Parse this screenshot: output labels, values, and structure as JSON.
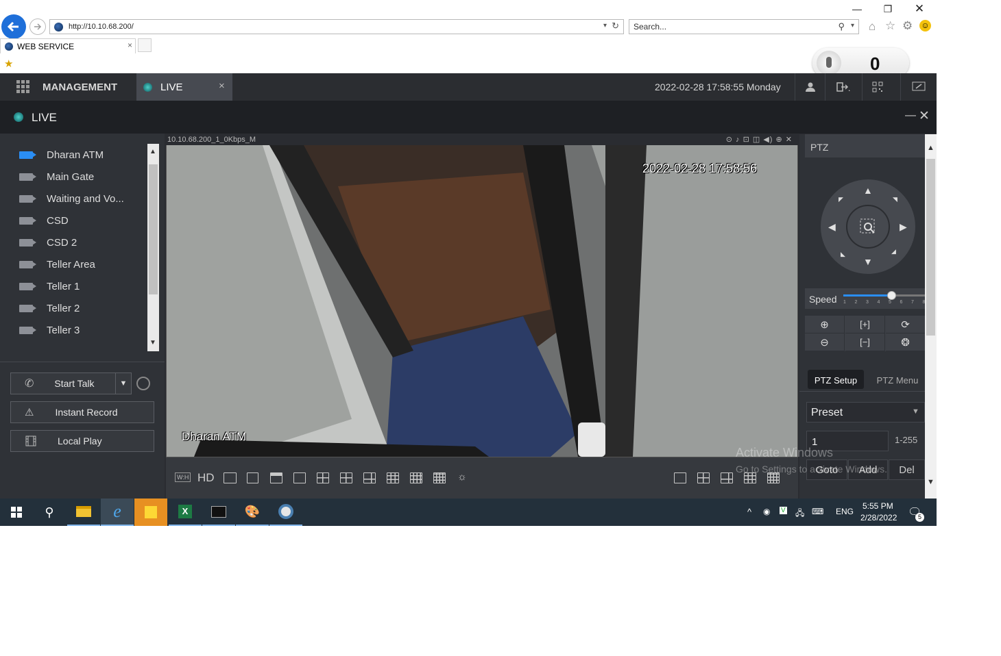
{
  "browser": {
    "address": "http://10.10.68.200/",
    "search_placeholder": "Search...",
    "tab_title": "WEB SERVICE",
    "notification_count": "0"
  },
  "topnav": {
    "management_label": "MANAGEMENT",
    "live_tab_label": "LIVE",
    "datetime": "2022-02-28 17:58:55 Monday"
  },
  "live_header": {
    "title": "LIVE"
  },
  "devices": [
    {
      "label": "Dharan ATM",
      "active": true
    },
    {
      "label": "Main Gate"
    },
    {
      "label": "Waiting and Vo..."
    },
    {
      "label": "CSD"
    },
    {
      "label": "CSD 2"
    },
    {
      "label": "Teller Area"
    },
    {
      "label": "Teller 1"
    },
    {
      "label": "Teller 2"
    },
    {
      "label": "Teller 3"
    }
  ],
  "left_buttons": {
    "start_talk": "Start Talk",
    "instant_record": "Instant Record",
    "local_play": "Local Play"
  },
  "video": {
    "stream_label": "10.10.68.200_1_0Kbps_M",
    "osd_timestamp": "2022-02-28 17:58:56",
    "osd_channel": "Dharan ATM",
    "hd_label": "HD",
    "wh_label": "W:H"
  },
  "ptz": {
    "title": "PTZ",
    "speed_label": "Speed",
    "speed_ticks": [
      "1",
      "2",
      "3",
      "4",
      "5",
      "6",
      "7",
      "8"
    ],
    "speed_value": 5,
    "setup_tab": "PTZ Setup",
    "menu_tab": "PTZ Menu",
    "preset_label": "Preset",
    "preset_value": "1",
    "preset_range": "1-255",
    "goto": "Goto",
    "add": "Add",
    "del": "Del"
  },
  "watermark": {
    "line1": "Activate Windows",
    "line2": "Go to Settings to activate Windows."
  },
  "taskbar": {
    "lang": "ENG",
    "time": "5:55 PM",
    "date": "2/28/2022",
    "notif_badge": "5"
  }
}
